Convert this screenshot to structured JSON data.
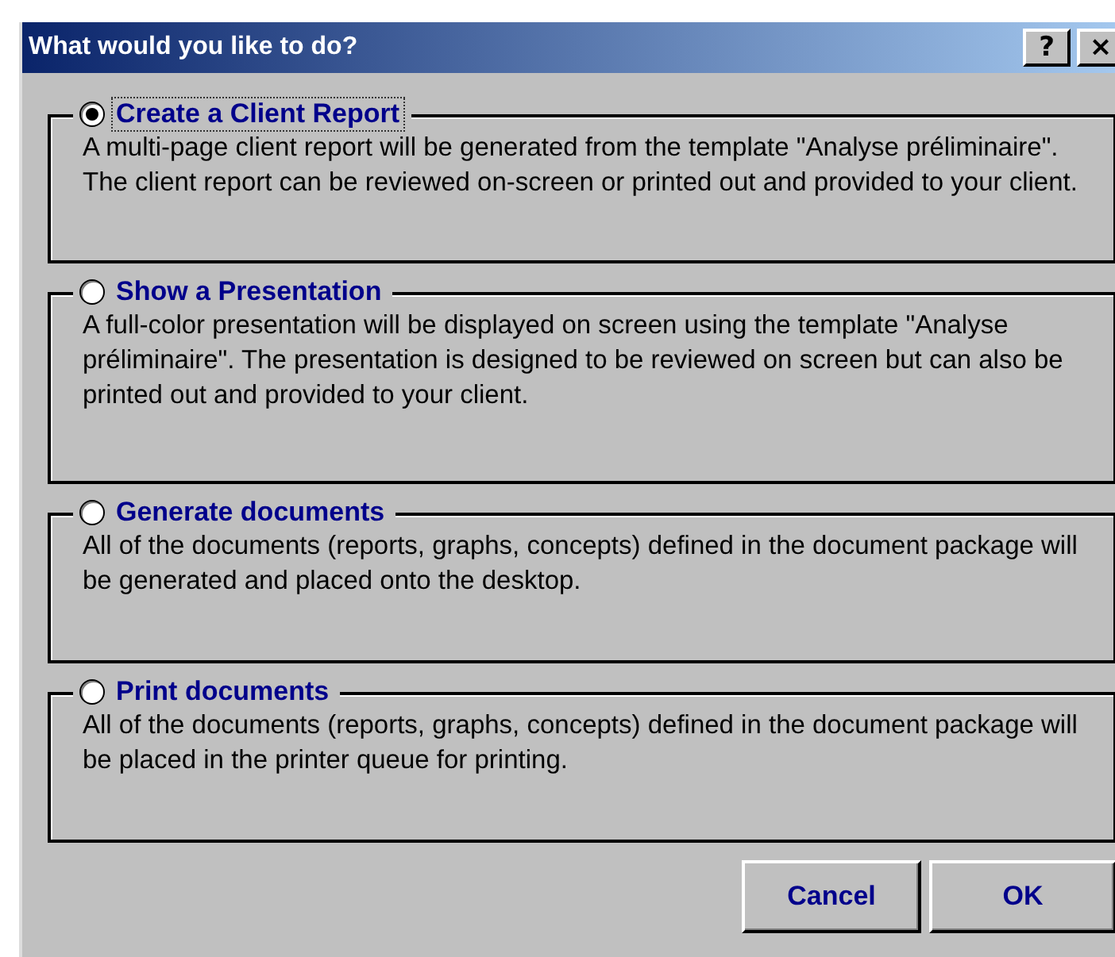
{
  "window": {
    "title": "What would you like to do?",
    "help_button": "?",
    "close_button": "×"
  },
  "options": [
    {
      "label": "Create a Client Report",
      "selected": true,
      "description": "A multi-page client report will be generated from the template \"Analyse préliminaire\". The client report can be reviewed on-screen or printed out and provided to your client."
    },
    {
      "label": "Show a Presentation",
      "selected": false,
      "description": "A full-color presentation will be displayed on screen using the template \"Analyse préliminaire\". The presentation is designed to be reviewed on screen but can also be printed out and provided to your client."
    },
    {
      "label": "Generate documents",
      "selected": false,
      "description": "All of the documents (reports, graphs, concepts) defined in the document package will be generated and placed onto the desktop."
    },
    {
      "label": "Print documents",
      "selected": false,
      "description": "All of the documents (reports, graphs, concepts) defined in the document package will be placed in the printer queue for printing."
    }
  ],
  "buttons": [
    "Cancel",
    "OK"
  ]
}
